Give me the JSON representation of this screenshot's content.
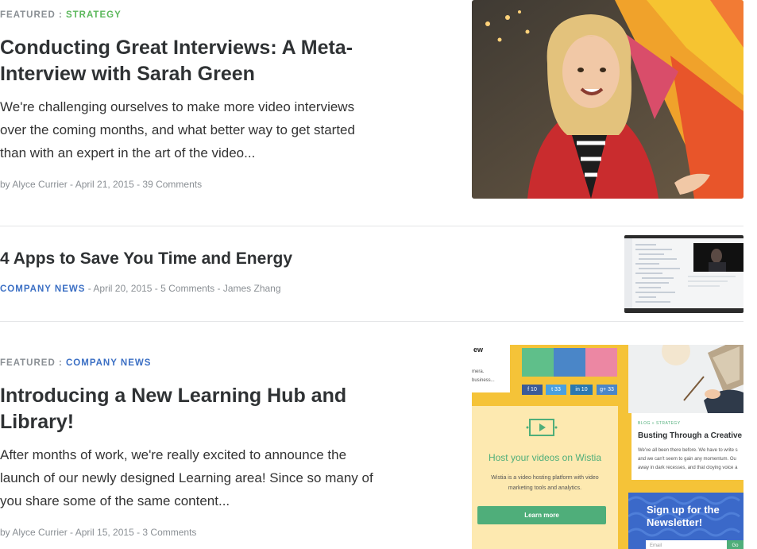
{
  "articles": [
    {
      "kicker_featured": "FEATURED :",
      "category": "STRATEGY",
      "category_color": "#5cb85c",
      "title_line1": "Conducting Great Interviews: A Meta-",
      "title_line2": "Interview with Sarah Green",
      "excerpt_lines": [
        "We're challenging ourselves to make more video interviews",
        "over the coming months, and what better way to get started",
        "than with an expert in the art of the video..."
      ],
      "meta": "by Alyce Currier - April 21, 2015 - 39 Comments"
    },
    {
      "title": "4 Apps to Save You Time and Energy",
      "category": "COMPANY NEWS",
      "category_color": "#3b6fc4",
      "meta": " - April 20, 2015 - 5 Comments - James Zhang"
    },
    {
      "kicker_featured": "FEATURED :",
      "category": "COMPANY NEWS",
      "category_color": "#3b6fc4",
      "title_line1": "Introducing a New Learning Hub and",
      "title_line2": "Library!",
      "excerpt_lines": [
        "After months of work, we're really excited to announce the",
        "launch of our newly designed Learning area! Since so many of",
        "you share some of the same content..."
      ],
      "meta": "by Alyce Currier - April 15, 2015 - 3 Comments"
    }
  ],
  "collage": {
    "top_text": "ew",
    "frag1": "mera.",
    "frag2": "business...",
    "social": [
      "10",
      "33",
      "10",
      "33"
    ],
    "host_title": "Host your videos on Wistia",
    "host_desc1": "Wistia is a video hosting platform with video",
    "host_desc2": "marketing tools and analytics.",
    "learn_more": "Learn more",
    "blog_kicker": "BLOG » STRATEGY",
    "blog_title": "Busting Through a Creative",
    "blog_desc1": "We've all been there before. We have to write s",
    "blog_desc2": "and we can't seem to gain any momentum. Ou",
    "blog_desc3": "away in dark recesses, and that cloying voice a",
    "signup1": "Sign up for the",
    "signup2": "Newsletter!",
    "email_placeholder": "Email",
    "go": "Go"
  }
}
